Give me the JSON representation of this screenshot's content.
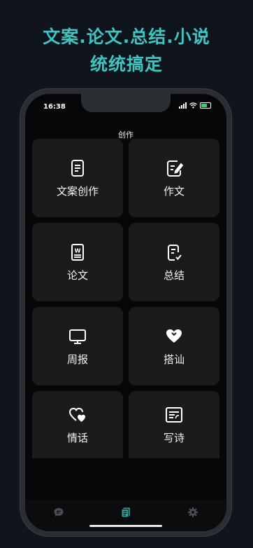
{
  "headline": {
    "line1": "文案.论文.总结.小说",
    "line2": "统统搞定"
  },
  "status_bar": {
    "time": "16:38"
  },
  "nav": {
    "title": "创作"
  },
  "cards": [
    {
      "label": "文案创作",
      "icon": "document-icon"
    },
    {
      "label": "作文",
      "icon": "edit-document-icon"
    },
    {
      "label": "论文",
      "icon": "word-document-icon"
    },
    {
      "label": "总结",
      "icon": "checklist-document-icon"
    },
    {
      "label": "周报",
      "icon": "monitor-icon"
    },
    {
      "label": "搭讪",
      "icon": "heart-icon"
    },
    {
      "label": "情话",
      "icon": "hearts-icon"
    },
    {
      "label": "写诗",
      "icon": "newspaper-icon"
    }
  ],
  "tabs": [
    {
      "name": "chat",
      "icon": "chat-bubble-icon",
      "active": false
    },
    {
      "name": "create",
      "icon": "copy-document-icon",
      "active": true
    },
    {
      "name": "settings",
      "icon": "gear-icon",
      "active": false
    }
  ],
  "colors": {
    "accent": "#3fc4c2",
    "active_tab": "#2aa39c",
    "inactive_tab": "#4a4d52"
  }
}
